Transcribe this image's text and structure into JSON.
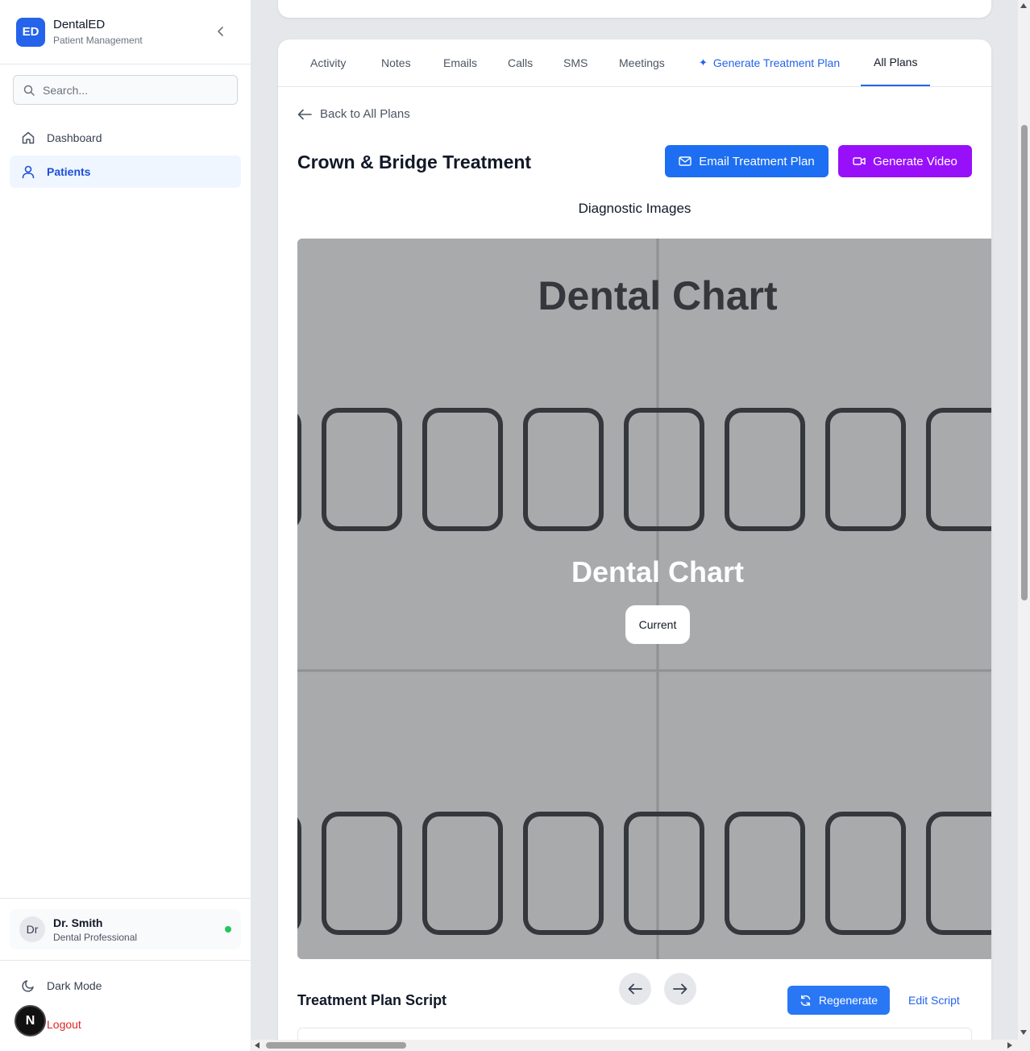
{
  "brand": {
    "logo_text": "ED",
    "name": "DentalED",
    "subtitle": "Patient Management"
  },
  "search": {
    "placeholder": "Search..."
  },
  "sidebar": {
    "items": [
      {
        "label": "Dashboard",
        "icon": "home-icon",
        "active": false
      },
      {
        "label": "Patients",
        "icon": "user-icon",
        "active": true
      }
    ]
  },
  "user": {
    "initials": "Dr",
    "name": "Dr. Smith",
    "role": "Dental Professional",
    "status_color": "#22c55e"
  },
  "footer": {
    "dark_mode_label": "Dark Mode",
    "logout_label": "Logout",
    "badge_letter": "N"
  },
  "tabs": [
    {
      "label": "Activity"
    },
    {
      "label": "Notes"
    },
    {
      "label": "Emails"
    },
    {
      "label": "Calls"
    },
    {
      "label": "SMS"
    },
    {
      "label": "Meetings"
    },
    {
      "label": "Generate Treatment Plan",
      "icon": "sparkle-icon"
    },
    {
      "label": "All Plans",
      "active": true
    }
  ],
  "plan": {
    "back_label": "Back to All Plans",
    "title": "Crown & Bridge Treatment",
    "email_button": "Email Treatment Plan",
    "video_button": "Generate Video",
    "diagnostic_title": "Diagnostic Images",
    "image": {
      "header": "Dental Chart",
      "overlay_title": "Dental Chart",
      "badge": "Current"
    },
    "script_title": "Treatment Plan Script",
    "regenerate_button": "Regenerate",
    "edit_script": "Edit Script"
  },
  "colors": {
    "primary": "#1d6ef2",
    "video": "#9810fa",
    "danger": "#dc2626",
    "active_bg": "#eff6ff"
  }
}
